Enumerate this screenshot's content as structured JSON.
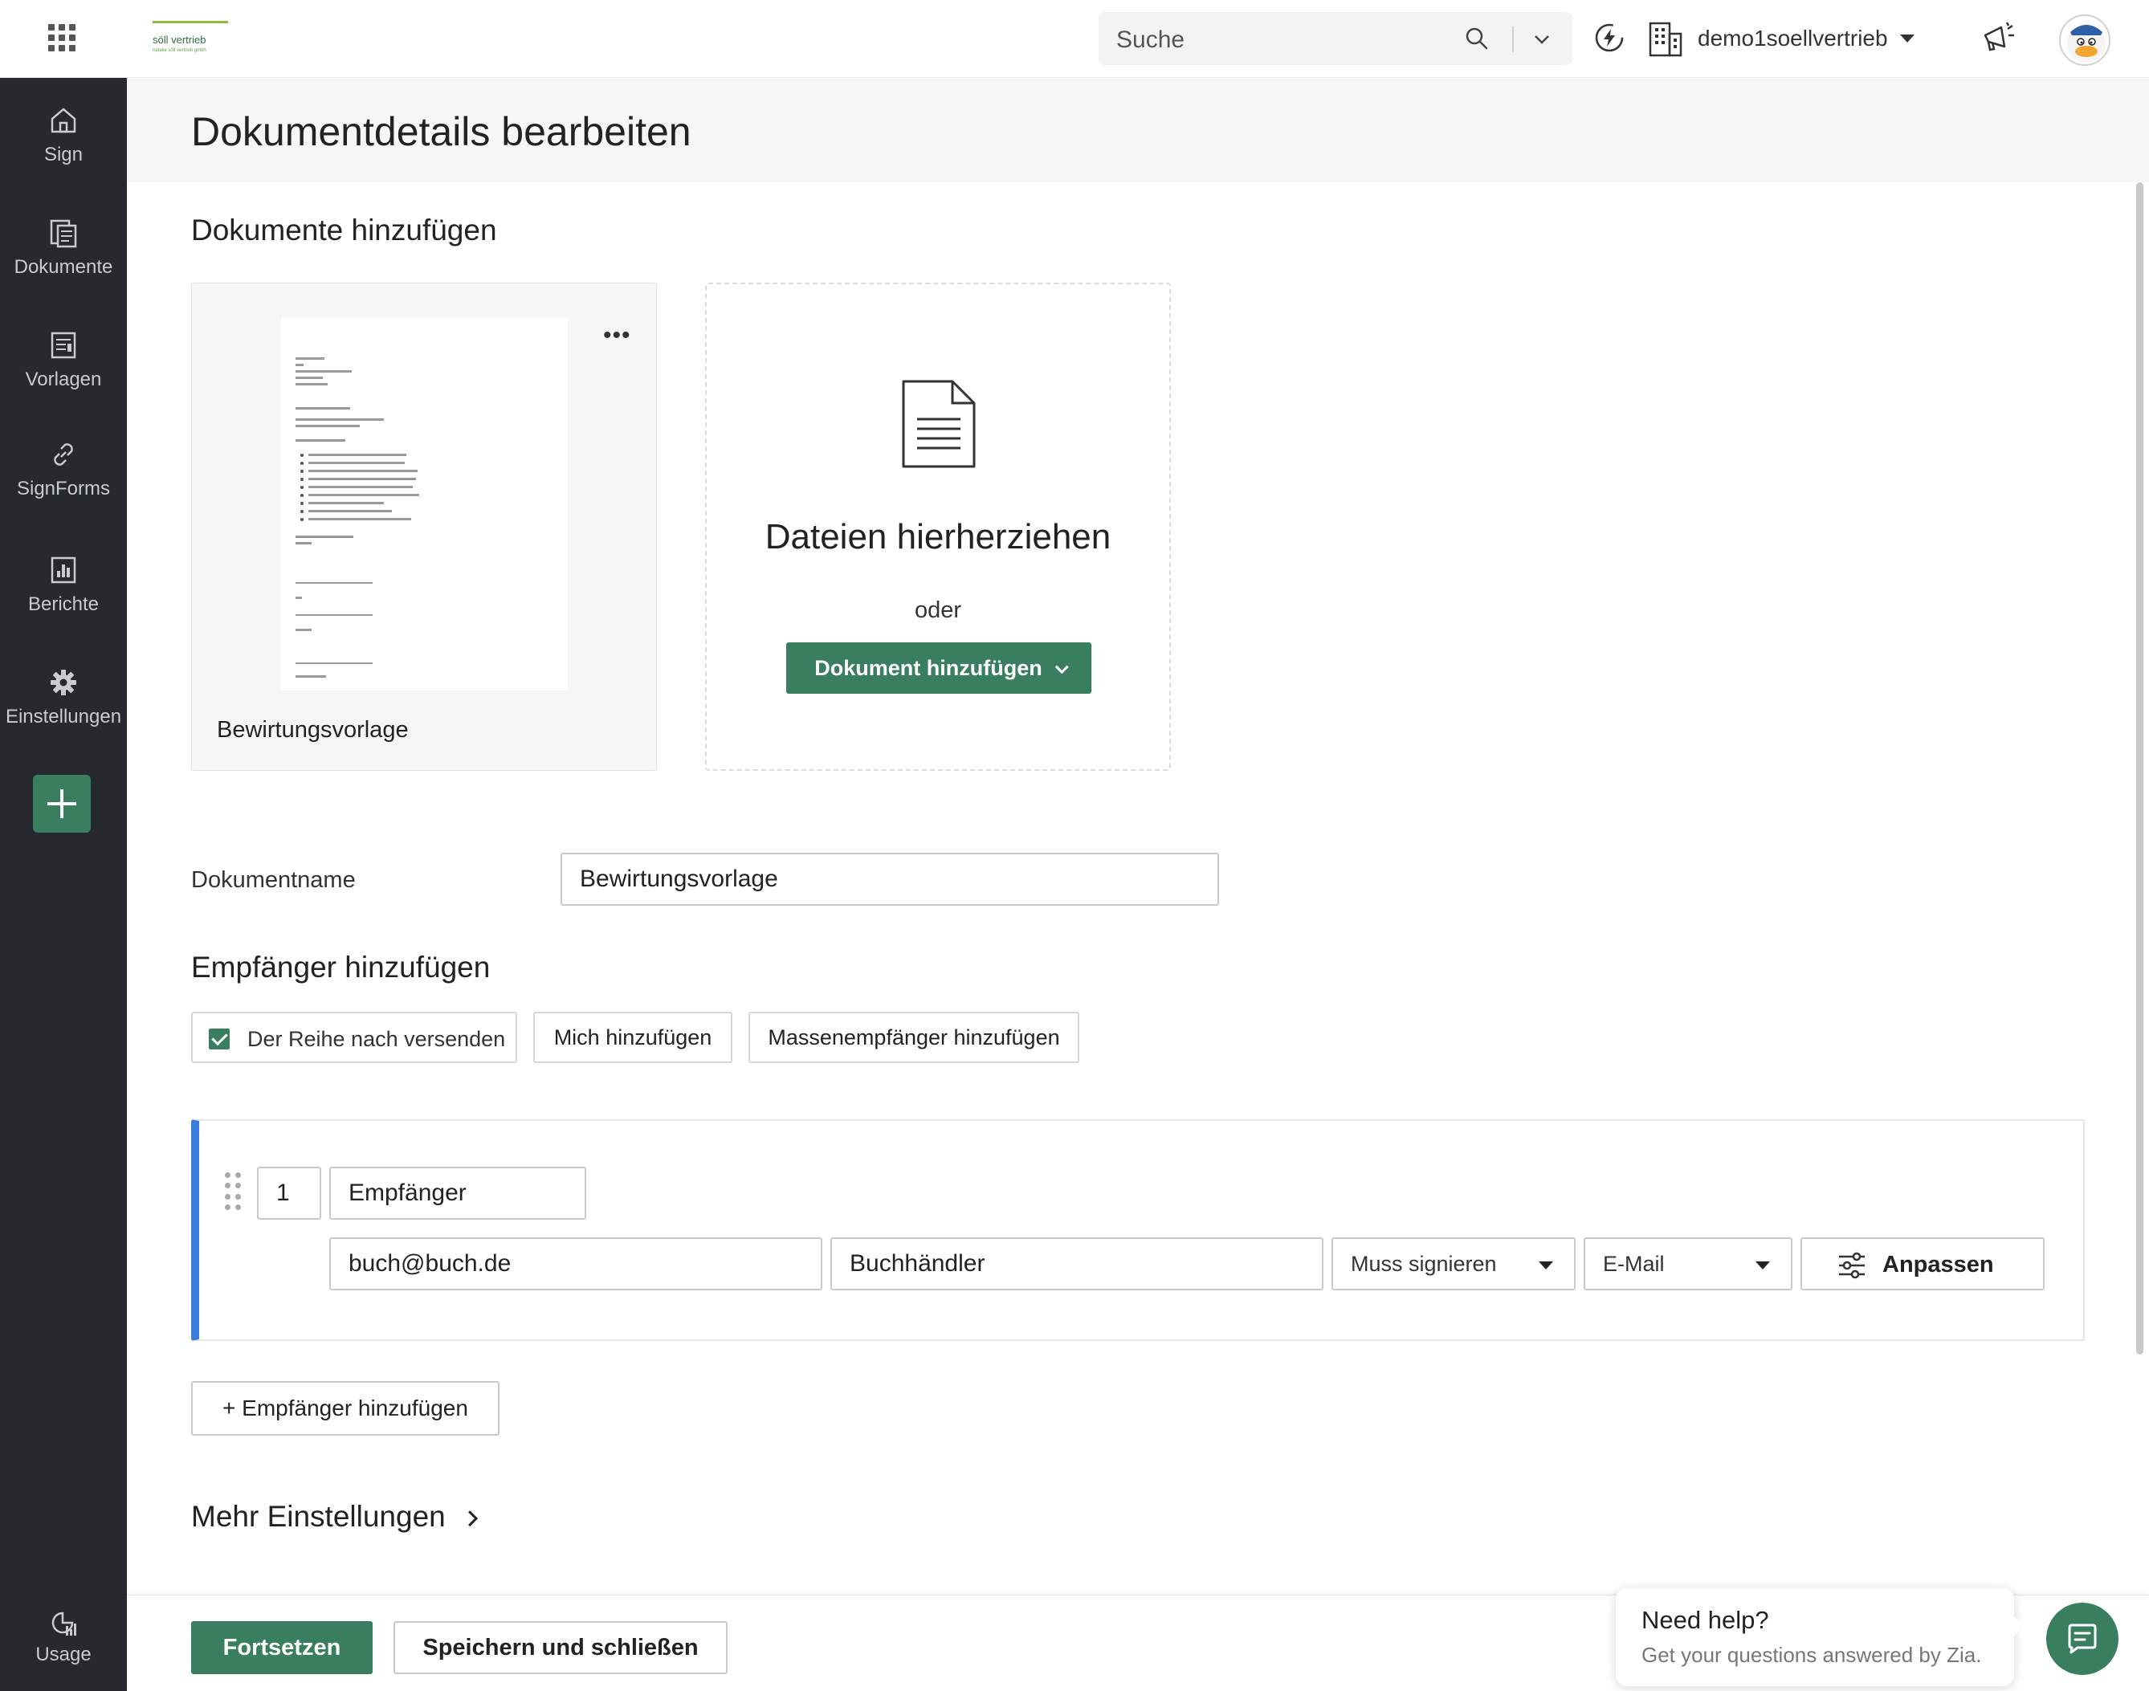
{
  "topbar": {
    "search_placeholder": "Suche",
    "org_name": "demo1soellvertrieb",
    "icons": [
      "apps-grid-icon",
      "search-icon",
      "chevron-down-icon",
      "bolt-icon",
      "building-icon",
      "megaphone-icon",
      "avatar"
    ]
  },
  "brand": {
    "logo_text": "söll vertrieb",
    "logo_subtext": "natalie söll vertrieb gmbh"
  },
  "sidebar": {
    "items": [
      {
        "label": "Sign",
        "icon": "home-icon"
      },
      {
        "label": "Dokumente",
        "icon": "documents-icon"
      },
      {
        "label": "Vorlagen",
        "icon": "templates-icon"
      },
      {
        "label": "SignForms",
        "icon": "link-icon"
      },
      {
        "label": "Berichte",
        "icon": "reports-icon"
      },
      {
        "label": "Einstellungen",
        "icon": "gear-icon"
      }
    ],
    "usage_label": "Usage"
  },
  "page": {
    "title": "Dokumentdetails bearbeiten"
  },
  "documents": {
    "section_title": "Dokumente hinzufügen",
    "card_label": "Bewirtungsvorlage",
    "menu_label": "•••",
    "dropzone_title": "Dateien hierherziehen",
    "dropzone_or": "oder",
    "add_button": "Dokument hinzufügen"
  },
  "docname": {
    "label": "Dokumentname",
    "value": "Bewirtungsvorlage"
  },
  "recipients": {
    "section_title": "Empfänger hinzufügen",
    "sequential_label": "Der Reihe nach versenden",
    "sequential_checked": true,
    "add_me": "Mich hinzufügen",
    "bulk_add": "Massenempfänger hinzufügen",
    "list": [
      {
        "order": "1",
        "type": "Empfänger",
        "email": "buch@buch.de",
        "name": "Buchhändler",
        "action": "Muss signieren",
        "delivery": "E-Mail",
        "customize": "Anpassen"
      }
    ],
    "add_recipient": "+ Empfänger hinzufügen"
  },
  "more_settings": "Mehr Einstellungen",
  "footer": {
    "continue": "Fortsetzen",
    "save_close": "Speichern und schließen"
  },
  "help": {
    "title": "Need help?",
    "subtitle": "Get your questions answered by Zia."
  },
  "colors": {
    "accent_green": "#3a7e60",
    "sidebar_bg": "#262a2f",
    "recipient_accent": "#3b7ddd"
  }
}
